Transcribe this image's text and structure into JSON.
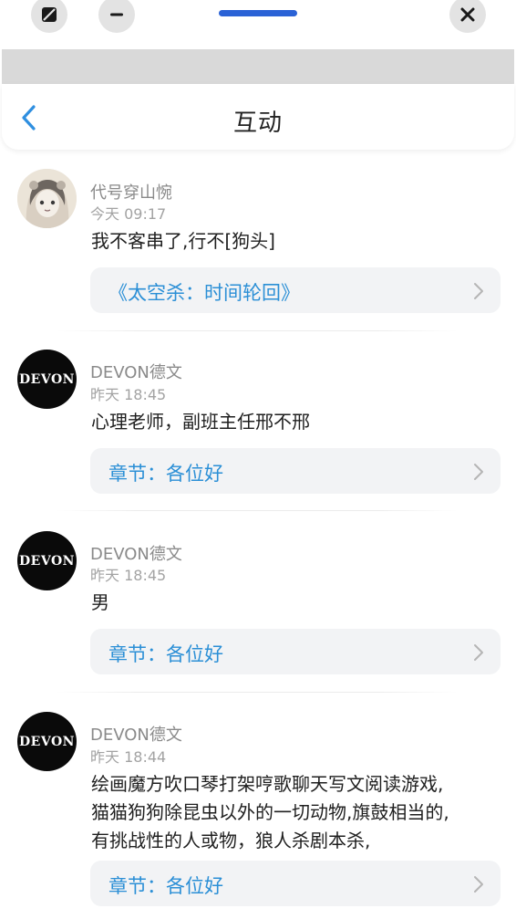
{
  "window": {
    "pip_icon": "picture-in-picture-icon",
    "minimize_icon": "minimize-icon",
    "close_icon": "close-icon"
  },
  "header": {
    "back_icon": "chevron-left-icon",
    "title": "互动"
  },
  "colors": {
    "accent": "#2b8fd6",
    "back": "#2f8fe0",
    "handle": "#2a62d6"
  },
  "comments": [
    {
      "name": "代号穿山惋",
      "time": "今天 09:17",
      "lines": [
        "我不客串了,行不[狗头]"
      ],
      "link": "《太空杀：时间轮回》",
      "avatar": "anime-girl-avatar"
    },
    {
      "name": "DEVON德文",
      "time": "昨天 18:45",
      "lines": [
        "心理老师，副班主任邢不邢"
      ],
      "link": "章节：各位好",
      "avatar_text": "DEVON"
    },
    {
      "name": "DEVON德文",
      "time": "昨天 18:45",
      "lines": [
        "男"
      ],
      "link": "章节：各位好",
      "avatar_text": "DEVON"
    },
    {
      "name": "DEVON德文",
      "time": "昨天 18:44",
      "lines": [
        "绘画魔方吹口琴打架哼歌聊天写文阅读游戏,",
        "猫猫狗狗除昆虫以外的一切动物,旗鼓相当的,",
        "有挑战性的人或物，狼人杀剧本杀,"
      ],
      "link": "章节：各位好",
      "avatar_text": "DEVON"
    }
  ]
}
